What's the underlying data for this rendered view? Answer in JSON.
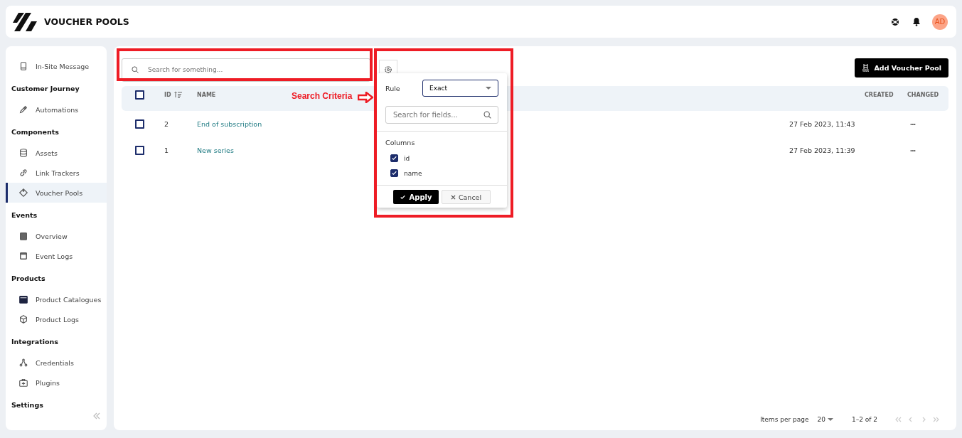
{
  "header": {
    "title": "VOUCHER POOLS",
    "avatar": "AD"
  },
  "sidebar": {
    "items": [
      {
        "kind": "item",
        "label": "In-Site Message",
        "selected": false
      },
      {
        "kind": "section",
        "label": "Customer Journey"
      },
      {
        "kind": "item",
        "label": "Automations",
        "selected": false
      },
      {
        "kind": "section",
        "label": "Components"
      },
      {
        "kind": "item",
        "label": "Assets",
        "selected": false
      },
      {
        "kind": "item",
        "label": "Link Trackers",
        "selected": false
      },
      {
        "kind": "item",
        "label": "Voucher Pools",
        "selected": true
      },
      {
        "kind": "section",
        "label": "Events"
      },
      {
        "kind": "item",
        "label": "Overview",
        "selected": false
      },
      {
        "kind": "item",
        "label": "Event Logs",
        "selected": false
      },
      {
        "kind": "section",
        "label": "Products"
      },
      {
        "kind": "item",
        "label": "Product Catalogues",
        "selected": false
      },
      {
        "kind": "item",
        "label": "Product Logs",
        "selected": false
      },
      {
        "kind": "section",
        "label": "Integrations"
      },
      {
        "kind": "item",
        "label": "Credentials",
        "selected": false
      },
      {
        "kind": "item",
        "label": "Plugins",
        "selected": false
      },
      {
        "kind": "section",
        "label": "Settings"
      }
    ]
  },
  "search": {
    "placeholder": "Search for something..."
  },
  "add_button": "Add Voucher Pool",
  "table": {
    "select_all_checked": false,
    "columns": [
      "ID",
      "NAME",
      "CREATED",
      "CHANGED"
    ],
    "rows": [
      {
        "checked": false,
        "id": "2",
        "name": "End of subscription",
        "created": "27 Feb 2023, 11:43",
        "more": "•••"
      },
      {
        "checked": false,
        "id": "1",
        "name": "New series",
        "created": "27 Feb 2023, 11:39",
        "more": "•••"
      }
    ]
  },
  "search_criteria": {
    "rule_label": "Rule",
    "rule_value": "Exact",
    "field_search_placeholder": "Search for fields...",
    "columns_label": "Columns",
    "columns": [
      {
        "label": "id",
        "checked": true
      },
      {
        "label": "name",
        "checked": true
      }
    ],
    "apply": "Apply",
    "cancel": "Cancel"
  },
  "annotation": {
    "label": "Search Criteria"
  },
  "pagination": {
    "label": "Items per page",
    "page_size": "20",
    "range": "1–2 of 2"
  }
}
